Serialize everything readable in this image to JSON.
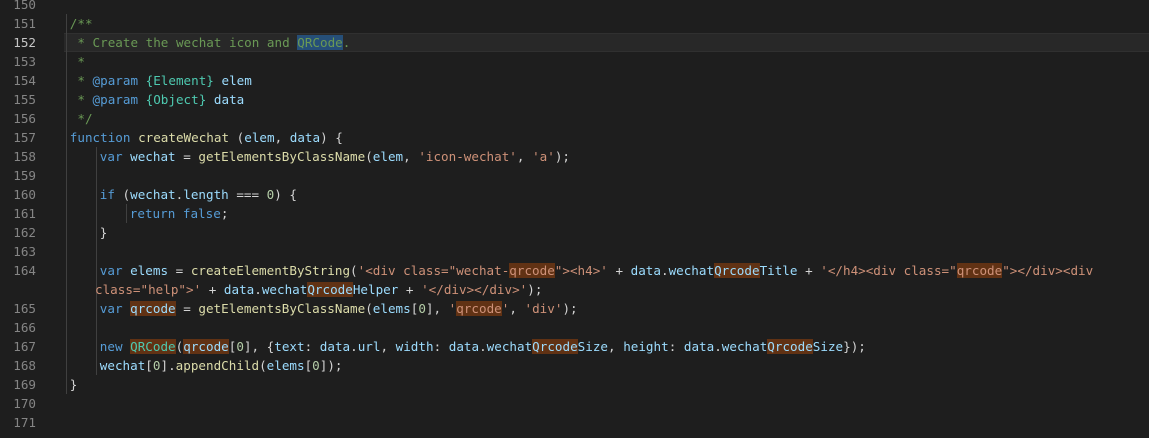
{
  "editor": {
    "current_line": 152,
    "search_term": "qrcode",
    "lines": [
      {
        "no": "150",
        "indent": 0,
        "wrap": false,
        "tokens": []
      },
      {
        "no": "151",
        "indent": 1,
        "wrap": false,
        "tokens": [
          {
            "t": "/**",
            "c": "comment"
          }
        ]
      },
      {
        "no": "152",
        "indent": 1,
        "wrap": false,
        "tokens": [
          {
            "t": " * Create the wechat icon and ",
            "c": "comment"
          },
          {
            "t": "QRCode",
            "c": "comment",
            "hl": "sel"
          },
          {
            "t": ".",
            "c": "comment"
          }
        ]
      },
      {
        "no": "153",
        "indent": 1,
        "wrap": false,
        "tokens": [
          {
            "t": " *",
            "c": "comment"
          }
        ]
      },
      {
        "no": "154",
        "indent": 1,
        "wrap": false,
        "tokens": [
          {
            "t": " * ",
            "c": "comment"
          },
          {
            "t": "@param",
            "c": "doctag"
          },
          {
            "t": " ",
            "c": "comment"
          },
          {
            "t": "{Element}",
            "c": "doctype"
          },
          {
            "t": " ",
            "c": "comment"
          },
          {
            "t": "elem",
            "c": "docvar"
          }
        ]
      },
      {
        "no": "155",
        "indent": 1,
        "wrap": false,
        "tokens": [
          {
            "t": " * ",
            "c": "comment"
          },
          {
            "t": "@param",
            "c": "doctag"
          },
          {
            "t": " ",
            "c": "comment"
          },
          {
            "t": "{Object}",
            "c": "doctype"
          },
          {
            "t": " ",
            "c": "comment"
          },
          {
            "t": "data",
            "c": "docvar"
          }
        ]
      },
      {
        "no": "156",
        "indent": 1,
        "wrap": false,
        "tokens": [
          {
            "t": " */",
            "c": "comment"
          }
        ]
      },
      {
        "no": "157",
        "indent": 1,
        "wrap": false,
        "tokens": [
          {
            "t": "function",
            "c": "keyword"
          },
          {
            "t": " ",
            "c": "punc"
          },
          {
            "t": "createWechat",
            "c": "fn"
          },
          {
            "t": " (",
            "c": "punc"
          },
          {
            "t": "elem",
            "c": "var"
          },
          {
            "t": ", ",
            "c": "punc"
          },
          {
            "t": "data",
            "c": "var"
          },
          {
            "t": ") {",
            "c": "punc"
          }
        ]
      },
      {
        "no": "158",
        "indent": 2,
        "wrap": false,
        "tokens": [
          {
            "t": "var",
            "c": "keyword"
          },
          {
            "t": " ",
            "c": "punc"
          },
          {
            "t": "wechat",
            "c": "var"
          },
          {
            "t": " = ",
            "c": "punc"
          },
          {
            "t": "getElementsByClassName",
            "c": "fn"
          },
          {
            "t": "(",
            "c": "punc"
          },
          {
            "t": "elem",
            "c": "var"
          },
          {
            "t": ", ",
            "c": "punc"
          },
          {
            "t": "'icon-wechat'",
            "c": "str"
          },
          {
            "t": ", ",
            "c": "punc"
          },
          {
            "t": "'a'",
            "c": "str"
          },
          {
            "t": ");",
            "c": "punc"
          }
        ]
      },
      {
        "no": "159",
        "indent": 2,
        "wrap": false,
        "tokens": []
      },
      {
        "no": "160",
        "indent": 2,
        "wrap": false,
        "tokens": [
          {
            "t": "if",
            "c": "keyword"
          },
          {
            "t": " (",
            "c": "punc"
          },
          {
            "t": "wechat",
            "c": "var"
          },
          {
            "t": ".",
            "c": "punc"
          },
          {
            "t": "length",
            "c": "var"
          },
          {
            "t": " === ",
            "c": "punc"
          },
          {
            "t": "0",
            "c": "num"
          },
          {
            "t": ") {",
            "c": "punc"
          }
        ]
      },
      {
        "no": "161",
        "indent": 3,
        "wrap": false,
        "tokens": [
          {
            "t": "return",
            "c": "keyword"
          },
          {
            "t": " ",
            "c": "punc"
          },
          {
            "t": "false",
            "c": "keyword"
          },
          {
            "t": ";",
            "c": "punc"
          }
        ]
      },
      {
        "no": "162",
        "indent": 2,
        "wrap": false,
        "tokens": [
          {
            "t": "}",
            "c": "punc"
          }
        ]
      },
      {
        "no": "163",
        "indent": 2,
        "wrap": false,
        "tokens": []
      },
      {
        "no": "164",
        "indent": 2,
        "wrap": false,
        "tokens": [
          {
            "t": "var",
            "c": "keyword"
          },
          {
            "t": " ",
            "c": "punc"
          },
          {
            "t": "elems",
            "c": "var"
          },
          {
            "t": " = ",
            "c": "punc"
          },
          {
            "t": "createElementByString",
            "c": "fn"
          },
          {
            "t": "(",
            "c": "punc"
          },
          {
            "t": "'<div class=\"wechat-",
            "c": "str"
          },
          {
            "t": "qrcode",
            "c": "str",
            "hl": "find"
          },
          {
            "t": "\"><h4>'",
            "c": "str"
          },
          {
            "t": " + ",
            "c": "punc"
          },
          {
            "t": "data",
            "c": "var"
          },
          {
            "t": ".",
            "c": "punc"
          },
          {
            "t": "wechat",
            "c": "var"
          },
          {
            "t": "Qrcode",
            "c": "var",
            "hl": "find"
          },
          {
            "t": "Title",
            "c": "var"
          },
          {
            "t": " + ",
            "c": "punc"
          },
          {
            "t": "'</h4><div class=\"",
            "c": "str"
          },
          {
            "t": "qrcode",
            "c": "str",
            "hl": "find"
          },
          {
            "t": "\"></div><div",
            "c": "str"
          }
        ]
      },
      {
        "no": "",
        "indent": 2,
        "wrap": true,
        "tokens": [
          {
            "t": "class=\"help\">'",
            "c": "str"
          },
          {
            "t": " + ",
            "c": "punc"
          },
          {
            "t": "data",
            "c": "var"
          },
          {
            "t": ".",
            "c": "punc"
          },
          {
            "t": "wechat",
            "c": "var"
          },
          {
            "t": "Qrcode",
            "c": "var",
            "hl": "find"
          },
          {
            "t": "Helper",
            "c": "var"
          },
          {
            "t": " + ",
            "c": "punc"
          },
          {
            "t": "'</div></div>'",
            "c": "str"
          },
          {
            "t": ");",
            "c": "punc"
          }
        ]
      },
      {
        "no": "165",
        "indent": 2,
        "wrap": false,
        "tokens": [
          {
            "t": "var",
            "c": "keyword"
          },
          {
            "t": " ",
            "c": "punc"
          },
          {
            "t": "qrcode",
            "c": "var",
            "hl": "find"
          },
          {
            "t": " = ",
            "c": "punc"
          },
          {
            "t": "getElementsByClassName",
            "c": "fn"
          },
          {
            "t": "(",
            "c": "punc"
          },
          {
            "t": "elems",
            "c": "var"
          },
          {
            "t": "[",
            "c": "punc"
          },
          {
            "t": "0",
            "c": "num"
          },
          {
            "t": "], ",
            "c": "punc"
          },
          {
            "t": "'",
            "c": "str"
          },
          {
            "t": "qrcode",
            "c": "str",
            "hl": "find"
          },
          {
            "t": "'",
            "c": "str"
          },
          {
            "t": ", ",
            "c": "punc"
          },
          {
            "t": "'div'",
            "c": "str"
          },
          {
            "t": ");",
            "c": "punc"
          }
        ]
      },
      {
        "no": "166",
        "indent": 2,
        "wrap": false,
        "tokens": []
      },
      {
        "no": "167",
        "indent": 2,
        "wrap": false,
        "tokens": [
          {
            "t": "new",
            "c": "keyword"
          },
          {
            "t": " ",
            "c": "punc"
          },
          {
            "t": "QRCode",
            "c": "class",
            "hl": "find"
          },
          {
            "t": "(",
            "c": "punc"
          },
          {
            "t": "qrcode",
            "c": "var",
            "hl": "find"
          },
          {
            "t": "[",
            "c": "punc"
          },
          {
            "t": "0",
            "c": "num"
          },
          {
            "t": "], {",
            "c": "punc"
          },
          {
            "t": "text",
            "c": "var"
          },
          {
            "t": ": ",
            "c": "punc"
          },
          {
            "t": "data",
            "c": "var"
          },
          {
            "t": ".",
            "c": "punc"
          },
          {
            "t": "url",
            "c": "var"
          },
          {
            "t": ", ",
            "c": "punc"
          },
          {
            "t": "width",
            "c": "var"
          },
          {
            "t": ": ",
            "c": "punc"
          },
          {
            "t": "data",
            "c": "var"
          },
          {
            "t": ".",
            "c": "punc"
          },
          {
            "t": "wechat",
            "c": "var"
          },
          {
            "t": "Qrcode",
            "c": "var",
            "hl": "find"
          },
          {
            "t": "Size",
            "c": "var"
          },
          {
            "t": ", ",
            "c": "punc"
          },
          {
            "t": "height",
            "c": "var"
          },
          {
            "t": ": ",
            "c": "punc"
          },
          {
            "t": "data",
            "c": "var"
          },
          {
            "t": ".",
            "c": "punc"
          },
          {
            "t": "wechat",
            "c": "var"
          },
          {
            "t": "Qrcode",
            "c": "var",
            "hl": "find"
          },
          {
            "t": "Size",
            "c": "var"
          },
          {
            "t": "});",
            "c": "punc"
          }
        ]
      },
      {
        "no": "168",
        "indent": 2,
        "wrap": false,
        "tokens": [
          {
            "t": "wechat",
            "c": "var"
          },
          {
            "t": "[",
            "c": "punc"
          },
          {
            "t": "0",
            "c": "num"
          },
          {
            "t": "].",
            "c": "punc"
          },
          {
            "t": "appendChild",
            "c": "fn"
          },
          {
            "t": "(",
            "c": "punc"
          },
          {
            "t": "elems",
            "c": "var"
          },
          {
            "t": "[",
            "c": "punc"
          },
          {
            "t": "0",
            "c": "num"
          },
          {
            "t": "]);",
            "c": "punc"
          }
        ]
      },
      {
        "no": "169",
        "indent": 1,
        "wrap": false,
        "tokens": [
          {
            "t": "}",
            "c": "punc"
          }
        ]
      },
      {
        "no": "170",
        "indent": 0,
        "wrap": false,
        "tokens": []
      },
      {
        "no": "171",
        "indent": 0,
        "wrap": false,
        "tokens": []
      }
    ]
  }
}
